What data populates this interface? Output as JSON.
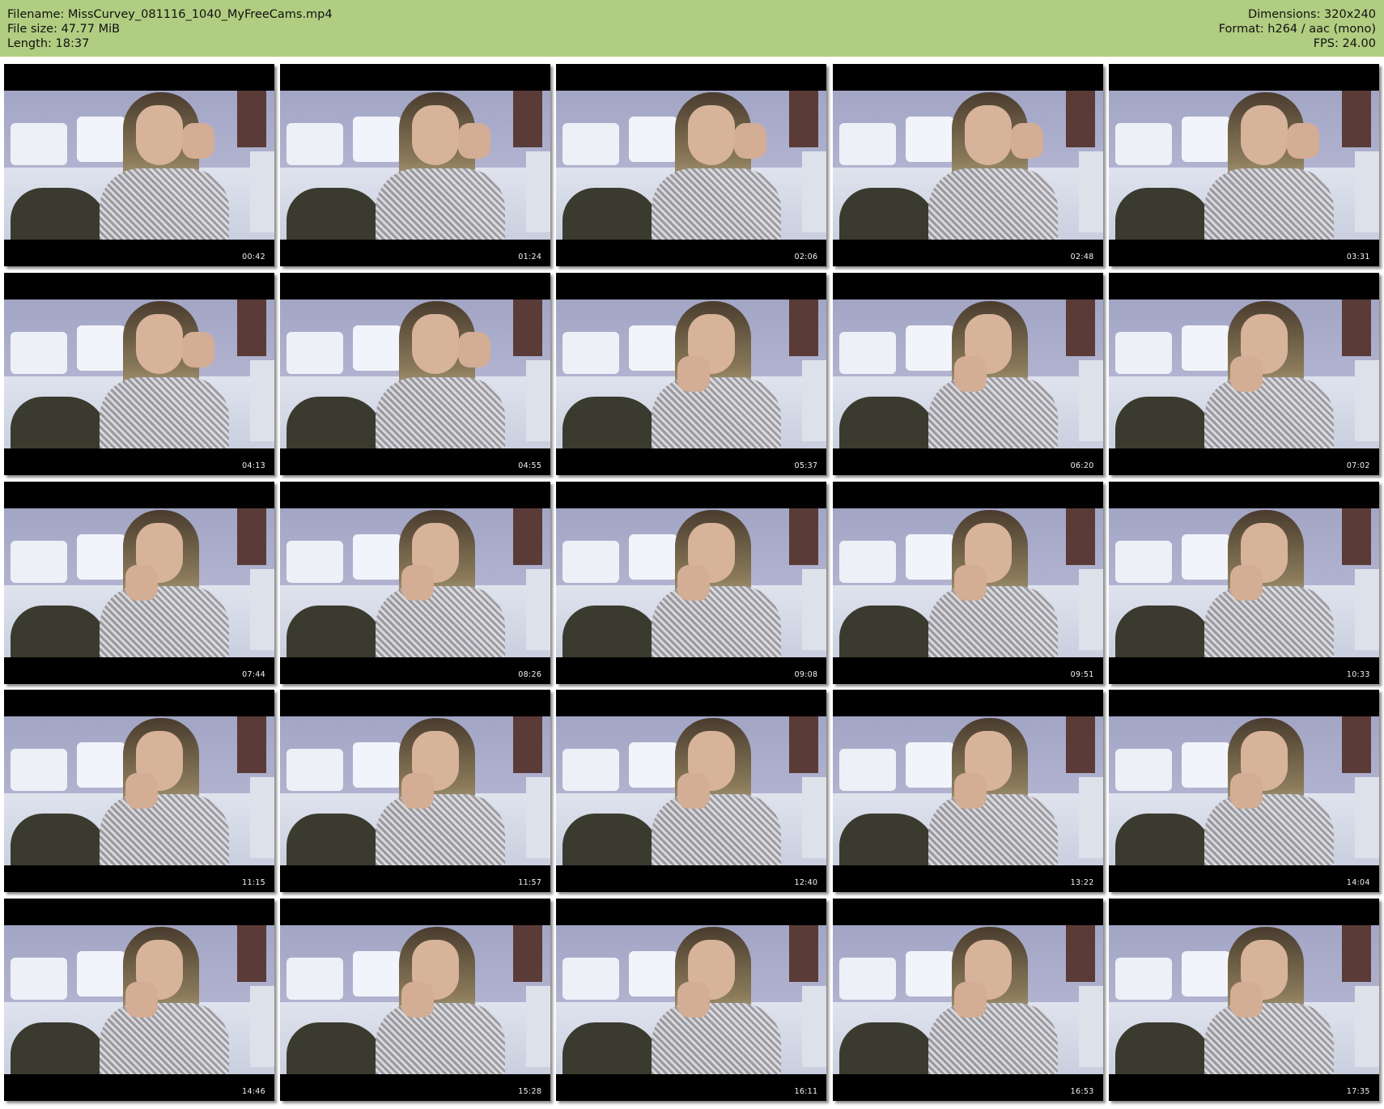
{
  "header": {
    "filename": "Filename: MissCurvey_081116_1040_MyFreeCams.mp4",
    "file_size": "File size: 47.77 MiB",
    "length": "Length: 18:37",
    "dimensions": "Dimensions: 320x240",
    "format": "Format: h264 / aac (mono)",
    "fps": "FPS: 24.00",
    "background_color": "#b1cd81"
  },
  "thumbnails": [
    {
      "time": "00:42"
    },
    {
      "time": "01:24"
    },
    {
      "time": "02:06"
    },
    {
      "time": "02:48"
    },
    {
      "time": "03:31"
    },
    {
      "time": "04:13"
    },
    {
      "time": "04:55"
    },
    {
      "time": "05:37"
    },
    {
      "time": "06:20"
    },
    {
      "time": "07:02"
    },
    {
      "time": "07:44"
    },
    {
      "time": "08:26"
    },
    {
      "time": "09:08"
    },
    {
      "time": "09:51"
    },
    {
      "time": "10:33"
    },
    {
      "time": "11:15"
    },
    {
      "time": "11:57"
    },
    {
      "time": "12:40"
    },
    {
      "time": "13:22"
    },
    {
      "time": "14:04"
    },
    {
      "time": "14:46"
    },
    {
      "time": "15:28"
    },
    {
      "time": "16:11"
    },
    {
      "time": "16:53"
    },
    {
      "time": "17:35"
    }
  ]
}
